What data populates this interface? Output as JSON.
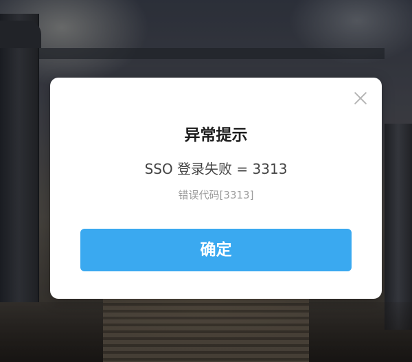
{
  "dialog": {
    "title": "异常提示",
    "message": "SSO 登录失败 = 3313",
    "error_code": "错误代码[3313]",
    "confirm_label": "确定",
    "close_icon": "close-icon"
  },
  "colors": {
    "button_bg": "#3aa9f0",
    "dialog_bg": "#ffffff",
    "title_text": "#1e1e1e",
    "secondary_text": "#9b9b9b"
  }
}
